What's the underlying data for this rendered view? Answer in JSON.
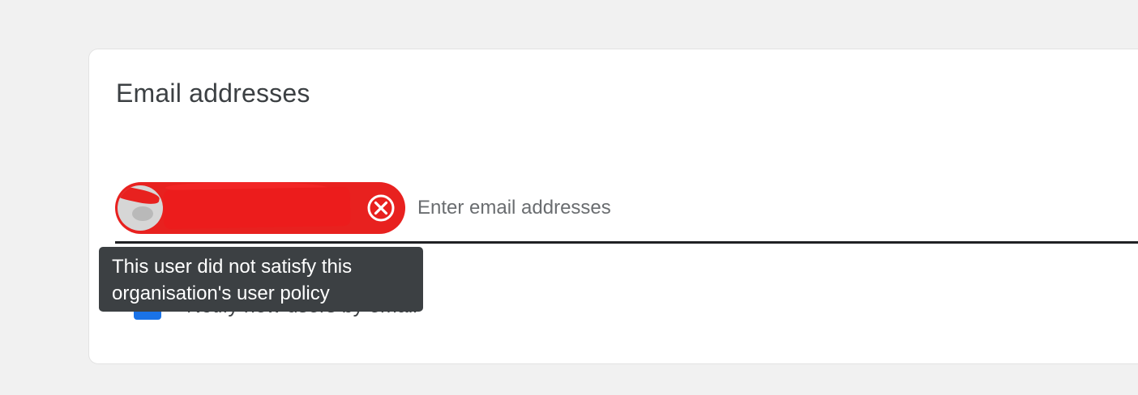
{
  "section": {
    "title": "Email addresses"
  },
  "recipients_field": {
    "placeholder": "Enter email addresses",
    "value": "",
    "chip": {
      "redacted": true,
      "status": "error",
      "color": "#e8211f",
      "remove_icon": "close-circle-icon"
    }
  },
  "notify_checkbox": {
    "label": "Notify new users by email",
    "checked": true,
    "color": "#1a73e8"
  },
  "tooltip": {
    "line1": "This user did not satisfy this",
    "line2": "organisation's user policy"
  },
  "colors": {
    "background": "#f1f1f1",
    "card": "#ffffff",
    "tooltip_bg": "#3c4043",
    "error_chip": "#e8211f",
    "accent": "#1a73e8"
  }
}
